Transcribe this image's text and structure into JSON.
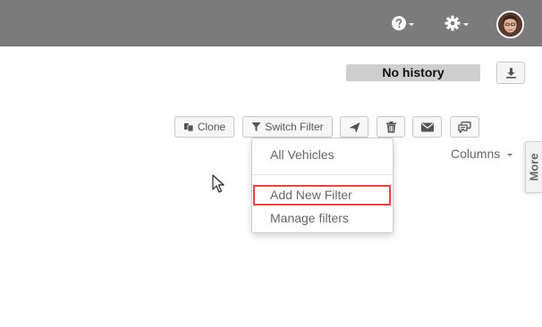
{
  "topbar": {
    "help_icon": "help-icon",
    "gear_icon": "gear-icon",
    "avatar_icon": "user-avatar"
  },
  "history": {
    "label": "No history"
  },
  "toolbar": {
    "clone_label": "Clone",
    "switch_filter_label": "Switch Filter",
    "icons": [
      "send-icon",
      "trash-icon",
      "mail-icon",
      "comment-icon"
    ]
  },
  "columns": {
    "label": "Columns"
  },
  "more_tab": {
    "label": "More"
  },
  "filter_menu": {
    "items": [
      {
        "label": "All Vehicles"
      },
      {
        "label": "Add New Filter",
        "highlighted": true
      },
      {
        "label": "Manage filters"
      }
    ]
  },
  "colors": {
    "topbar": "#7b7b7b",
    "highlight_border": "#e04848"
  }
}
